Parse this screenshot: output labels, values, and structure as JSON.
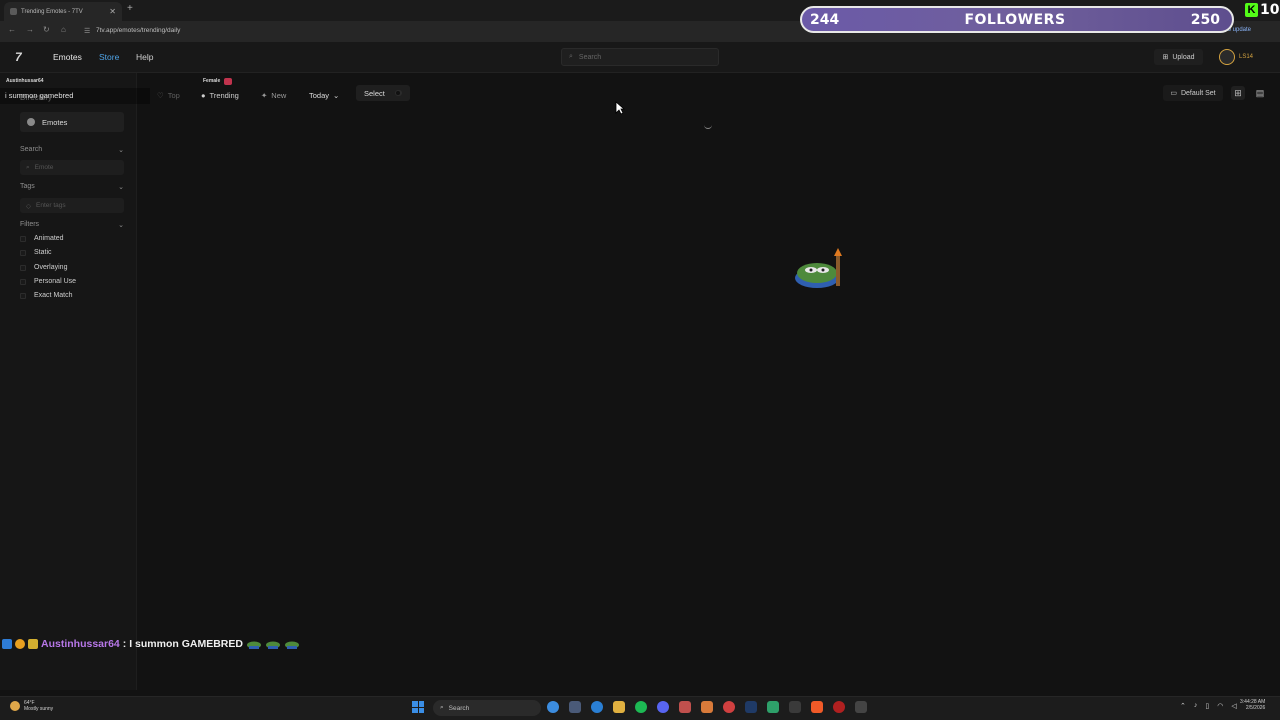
{
  "browser": {
    "tab_title": "Trending Emotes - 7TV",
    "url": "7tv.app/emotes/trending/daily",
    "update_hint": "to update"
  },
  "site": {
    "nav": {
      "emotes": "Emotes",
      "store": "Store",
      "help": "Help"
    },
    "search_placeholder": "Search",
    "upload_label": "Upload",
    "user_label": "LS14"
  },
  "sidebar": {
    "title": "Directory",
    "emotes_item": "Emotes",
    "search_title": "Search",
    "emote_placeholder": "Emote",
    "tags_title": "Tags",
    "tags_placeholder": "Enter tags",
    "filters_title": "Filters",
    "filters": [
      "Animated",
      "Static",
      "Overlaying",
      "Personal Use",
      "Exact Match"
    ]
  },
  "toolbar": {
    "top": "Top",
    "trending": "Trending",
    "new": "New",
    "period": "Today",
    "select": "Select",
    "default_set": "Default Set"
  },
  "overlay": {
    "top_user": "Austinhussar64",
    "top_message": "i summon gamebred",
    "female_label": "Female",
    "followers_current": "244",
    "followers_label": "FOLLOWERS",
    "followers_goal": "250",
    "followers_progress": 0.976,
    "kick_count": "10",
    "chat_user": "Austinhussar64",
    "chat_text": ": I summon GAMEBRED"
  },
  "taskbar": {
    "weather_temp": "64°F",
    "weather_desc": "Mostly sunny",
    "search": "Search",
    "time": "3:44:28 AM",
    "date": "2/5/2026"
  },
  "colors": {
    "background": "#121212",
    "store_link": "#4fa3e6",
    "followers_bar": "#6b5aa8",
    "chat_user": "#b777e8",
    "kick_green": "#53fc18"
  }
}
